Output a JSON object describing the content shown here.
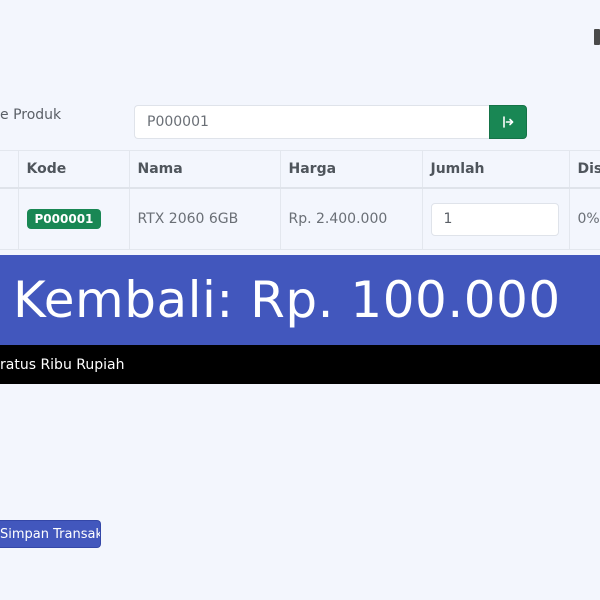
{
  "product_form": {
    "label": "e Produk",
    "code_value": "P000001"
  },
  "table": {
    "columns": [
      "",
      "Kode",
      "Nama",
      "Harga",
      "Jumlah",
      "Disk"
    ],
    "rows": [
      {
        "kode": "P000001",
        "nama": "RTX 2060 6GB",
        "harga": "Rp. 2.400.000",
        "jumlah": "1",
        "diskon": "0%"
      }
    ]
  },
  "change": {
    "text": "Kembali: Rp. 100.000",
    "in_words": "ratus Ribu Rupiah"
  },
  "actions": {
    "save_label": "Simpan Transaksi"
  },
  "colors": {
    "primary": "#4257bd",
    "success": "#198754",
    "background": "#f3f6fd",
    "words_background": "#000000"
  },
  "icons": {
    "submit": "enter-arrow-icon"
  }
}
